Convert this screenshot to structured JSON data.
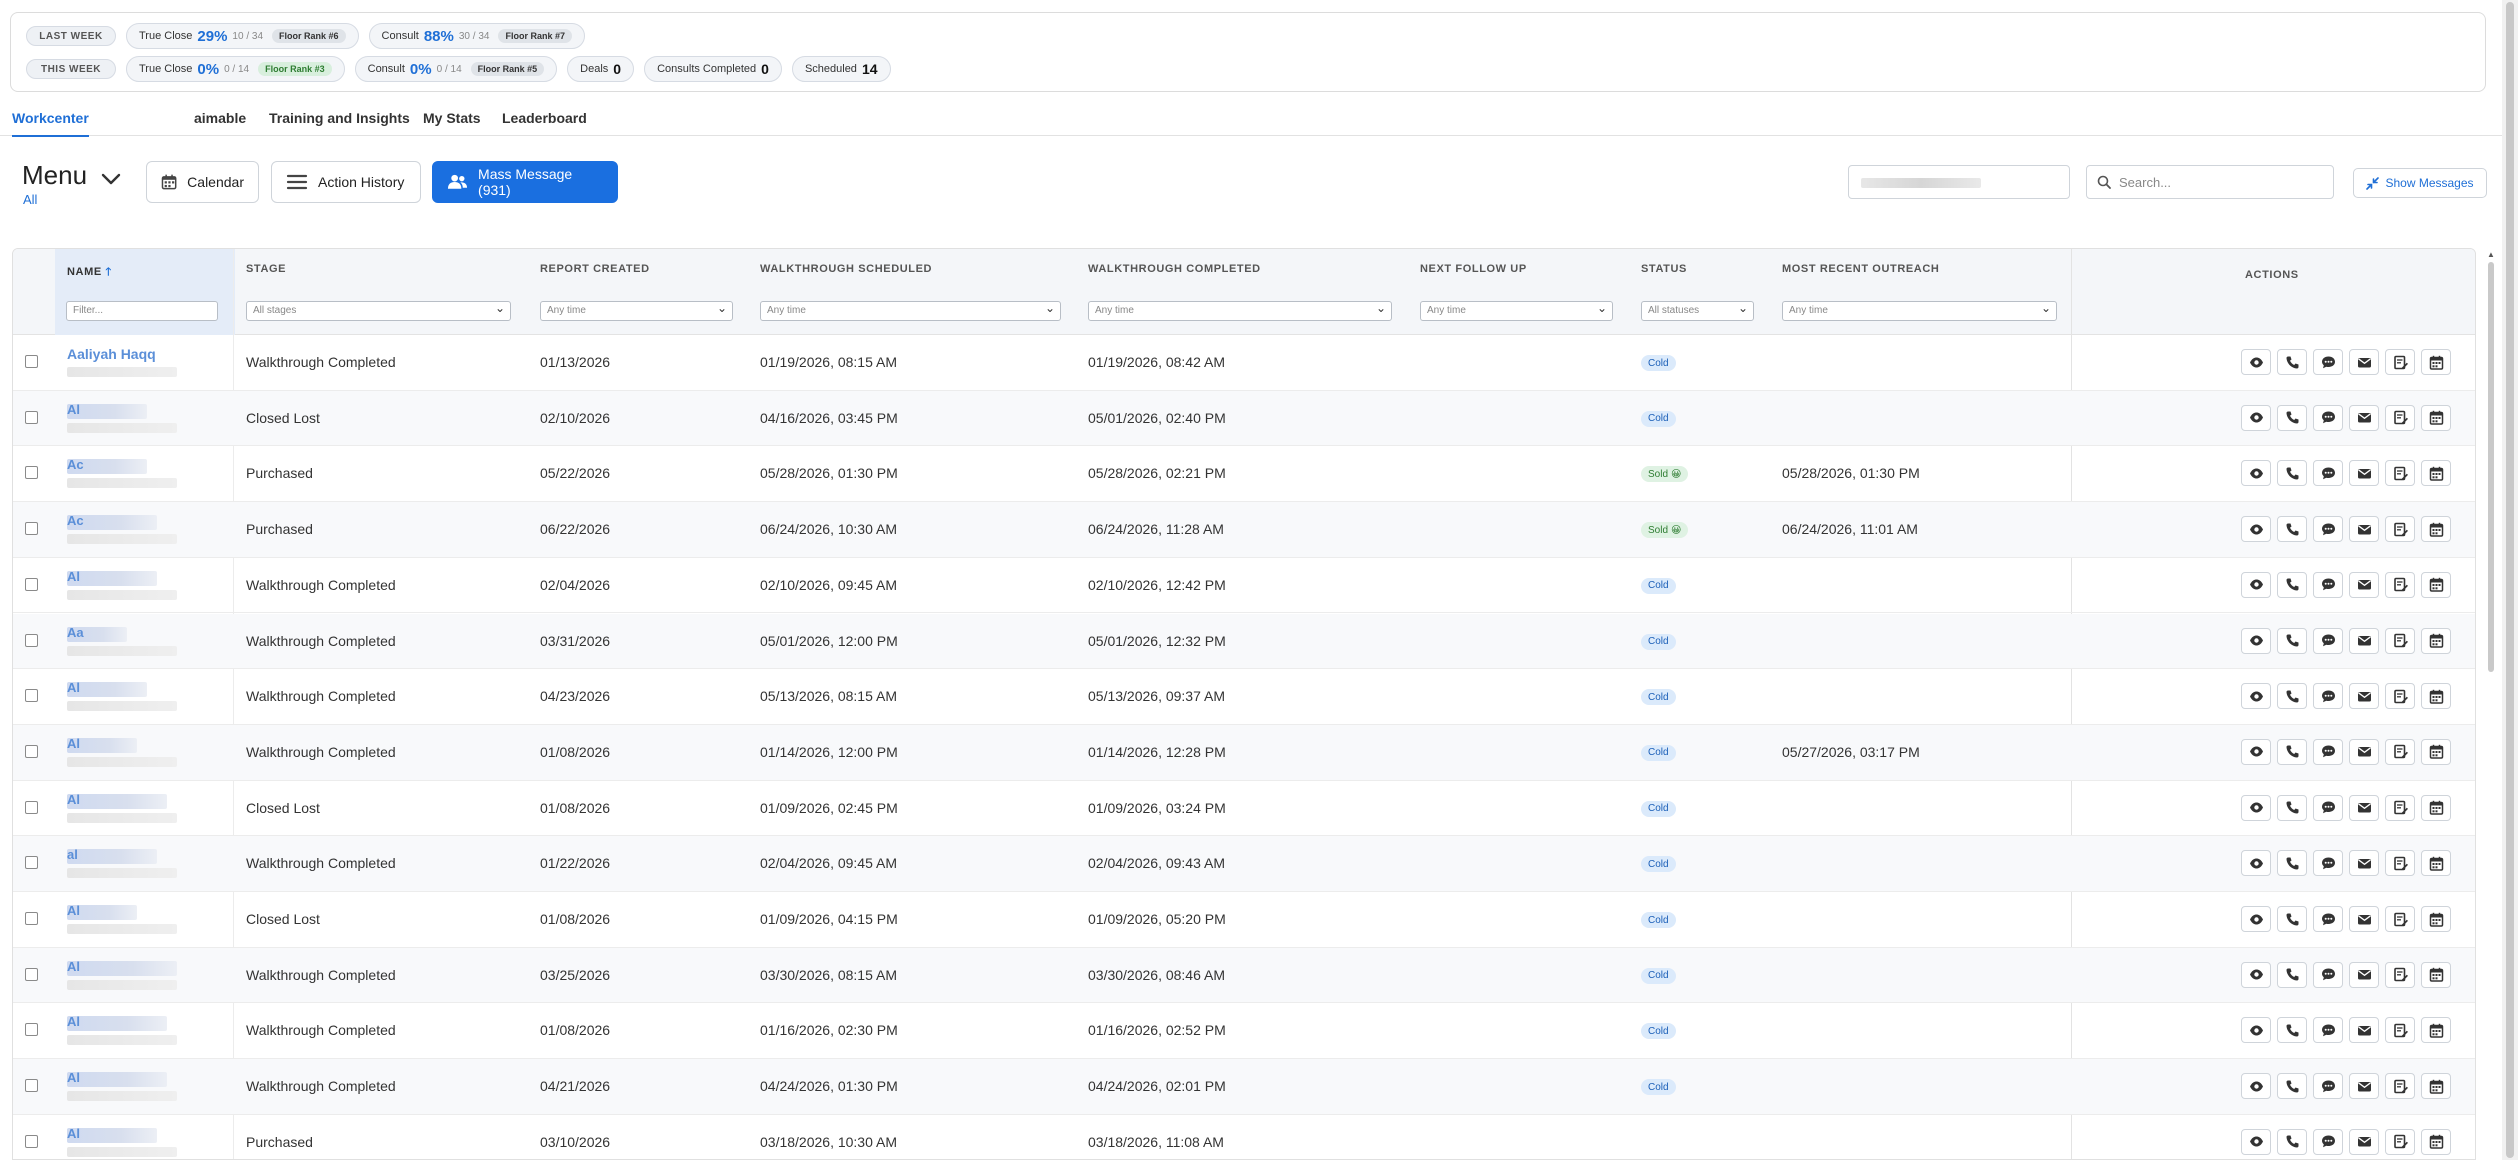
{
  "stats": {
    "last_week": {
      "label": "LAST WEEK",
      "true_close": {
        "label": "True Close",
        "pct": "29%",
        "frac": "10 / 34",
        "rank": "Floor Rank #6"
      },
      "consult": {
        "label": "Consult",
        "pct": "88%",
        "frac": "30 / 34",
        "rank": "Floor Rank #7"
      }
    },
    "this_week": {
      "label": "THIS WEEK",
      "true_close": {
        "label": "True Close",
        "pct": "0%",
        "frac": "0 / 14",
        "rank": "Floor Rank #3"
      },
      "consult": {
        "label": "Consult",
        "pct": "0%",
        "frac": "0 / 14",
        "rank": "Floor Rank #5"
      },
      "deals": {
        "label": "Deals",
        "value": "0"
      },
      "consults_completed": {
        "label": "Consults Completed",
        "value": "0"
      },
      "scheduled": {
        "label": "Scheduled",
        "value": "14"
      }
    }
  },
  "tabs": [
    {
      "label": "Workcenter",
      "active": true
    },
    {
      "label": "aimable"
    },
    {
      "label": "Training and Insights"
    },
    {
      "label": "My Stats"
    },
    {
      "label": "Leaderboard"
    }
  ],
  "menu": {
    "title": "Menu",
    "filter": "All"
  },
  "toolbar": {
    "calendar": "Calendar",
    "action_history": "Action History",
    "mass_message": "Mass Message (931)",
    "search_placeholder": "Search...",
    "show_messages": "Show Messages"
  },
  "columns": {
    "name": "NAME",
    "stage": "STAGE",
    "report_created": "REPORT CREATED",
    "walkthrough_scheduled": "WALKTHROUGH SCHEDULED",
    "walkthrough_completed": "WALKTHROUGH COMPLETED",
    "next_follow_up": "NEXT FOLLOW UP",
    "status": "STATUS",
    "most_recent_outreach": "MOST RECENT OUTREACH",
    "actions": "ACTIONS"
  },
  "filters": {
    "name": "Filter...",
    "stage": "All stages",
    "report_created": "Any time",
    "walkthrough_scheduled": "Any time",
    "walkthrough_completed": "Any time",
    "next_follow_up": "Any time",
    "status": "All statuses",
    "most_recent_outreach": "Any time"
  },
  "rows": [
    {
      "name": "Aaliyah Haqq",
      "stage": "Walkthrough Completed",
      "report_created": "01/13/2026",
      "scheduled": "01/19/2026, 08:15 AM",
      "completed": "01/19/2026, 08:42 AM",
      "follow_up": "",
      "status": "Cold",
      "outreach": ""
    },
    {
      "name": "Al",
      "stage": "Closed Lost",
      "report_created": "02/10/2026",
      "scheduled": "04/16/2026, 03:45 PM",
      "completed": "05/01/2026, 02:40 PM",
      "follow_up": "",
      "status": "Cold",
      "outreach": ""
    },
    {
      "name": "Ac",
      "stage": "Purchased",
      "report_created": "05/22/2026",
      "scheduled": "05/28/2026, 01:30 PM",
      "completed": "05/28/2026, 02:21 PM",
      "follow_up": "",
      "status": "Sold",
      "outreach": "05/28/2026, 01:30 PM"
    },
    {
      "name": "Ac",
      "stage": "Purchased",
      "report_created": "06/22/2026",
      "scheduled": "06/24/2026, 10:30 AM",
      "completed": "06/24/2026, 11:28 AM",
      "follow_up": "",
      "status": "Sold",
      "outreach": "06/24/2026, 11:01 AM"
    },
    {
      "name": "Al",
      "stage": "Walkthrough Completed",
      "report_created": "02/04/2026",
      "scheduled": "02/10/2026, 09:45 AM",
      "completed": "02/10/2026, 12:42 PM",
      "follow_up": "",
      "status": "Cold",
      "outreach": ""
    },
    {
      "name": "Aa",
      "stage": "Walkthrough Completed",
      "report_created": "03/31/2026",
      "scheduled": "05/01/2026, 12:00 PM",
      "completed": "05/01/2026, 12:32 PM",
      "follow_up": "",
      "status": "Cold",
      "outreach": ""
    },
    {
      "name": "Al",
      "stage": "Walkthrough Completed",
      "report_created": "04/23/2026",
      "scheduled": "05/13/2026, 08:15 AM",
      "completed": "05/13/2026, 09:37 AM",
      "follow_up": "",
      "status": "Cold",
      "outreach": ""
    },
    {
      "name": "Al",
      "stage": "Walkthrough Completed",
      "report_created": "01/08/2026",
      "scheduled": "01/14/2026, 12:00 PM",
      "completed": "01/14/2026, 12:28 PM",
      "follow_up": "",
      "status": "Cold",
      "outreach": "05/27/2026, 03:17 PM"
    },
    {
      "name": "Al",
      "stage": "Closed Lost",
      "report_created": "01/08/2026",
      "scheduled": "01/09/2026, 02:45 PM",
      "completed": "01/09/2026, 03:24 PM",
      "follow_up": "",
      "status": "Cold",
      "outreach": ""
    },
    {
      "name": "al",
      "stage": "Walkthrough Completed",
      "report_created": "01/22/2026",
      "scheduled": "02/04/2026, 09:45 AM",
      "completed": "02/04/2026, 09:43 AM",
      "follow_up": "",
      "status": "Cold",
      "outreach": ""
    },
    {
      "name": "Al",
      "stage": "Closed Lost",
      "report_created": "01/08/2026",
      "scheduled": "01/09/2026, 04:15 PM",
      "completed": "01/09/2026, 05:20 PM",
      "follow_up": "",
      "status": "Cold",
      "outreach": ""
    },
    {
      "name": "Al",
      "stage": "Walkthrough Completed",
      "report_created": "03/25/2026",
      "scheduled": "03/30/2026, 08:15 AM",
      "completed": "03/30/2026, 08:46 AM",
      "follow_up": "",
      "status": "Cold",
      "outreach": ""
    },
    {
      "name": "Al",
      "stage": "Walkthrough Completed",
      "report_created": "01/08/2026",
      "scheduled": "01/16/2026, 02:30 PM",
      "completed": "01/16/2026, 02:52 PM",
      "follow_up": "",
      "status": "Cold",
      "outreach": ""
    },
    {
      "name": "Al",
      "stage": "Walkthrough Completed",
      "report_created": "04/21/2026",
      "scheduled": "04/24/2026, 01:30 PM",
      "completed": "04/24/2026, 02:01 PM",
      "follow_up": "",
      "status": "Cold",
      "outreach": ""
    },
    {
      "name": "Al",
      "stage": "Purchased",
      "report_created": "03/10/2026",
      "scheduled": "03/18/2026, 10:30 AM",
      "completed": "03/18/2026, 11:08 AM",
      "follow_up": "",
      "status": "",
      "outreach": ""
    }
  ],
  "action_icons": [
    "eye-icon",
    "phone-icon",
    "chat-icon",
    "mail-icon",
    "note-icon",
    "calendar-icon"
  ],
  "colors": {
    "accent": "#1a6fe0",
    "cold_bg": "#dbeafb",
    "sold_bg": "#dff2e3"
  }
}
